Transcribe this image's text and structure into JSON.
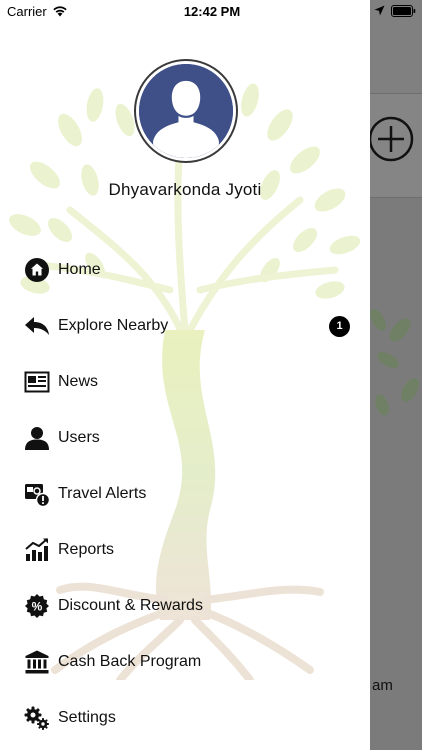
{
  "status_bar": {
    "carrier": "Carrier",
    "time": "12:42 PM",
    "wifi_icon": "wifi-icon",
    "location_icon": "location-arrow-icon",
    "battery_icon": "battery-full-icon"
  },
  "drawer": {
    "avatar_icon": "user-silhouette-icon",
    "user_name": "Dhyavarkonda Jyoti",
    "background": "tree-illustration",
    "menu": [
      {
        "label": "Home",
        "icon": "home-icon"
      },
      {
        "label": "Explore Nearby",
        "icon": "reply-arrow-icon",
        "badge": "1"
      },
      {
        "label": "News",
        "icon": "newspaper-icon"
      },
      {
        "label": "Users",
        "icon": "user-icon"
      },
      {
        "label": "Travel Alerts",
        "icon": "travel-alert-icon"
      },
      {
        "label": "Reports",
        "icon": "bar-chart-icon"
      },
      {
        "label": "Discount & Rewards",
        "icon": "percent-badge-icon"
      },
      {
        "label": "Cash Back Program",
        "icon": "bank-icon"
      },
      {
        "label": "Settings",
        "icon": "gears-icon"
      }
    ]
  },
  "underlay": {
    "add_icon": "plus-circle-icon",
    "partial_text": "am"
  },
  "colors": {
    "avatar_bg": "#3f5089",
    "overlay": "#7b7b7b",
    "badge_bg": "#000000"
  }
}
